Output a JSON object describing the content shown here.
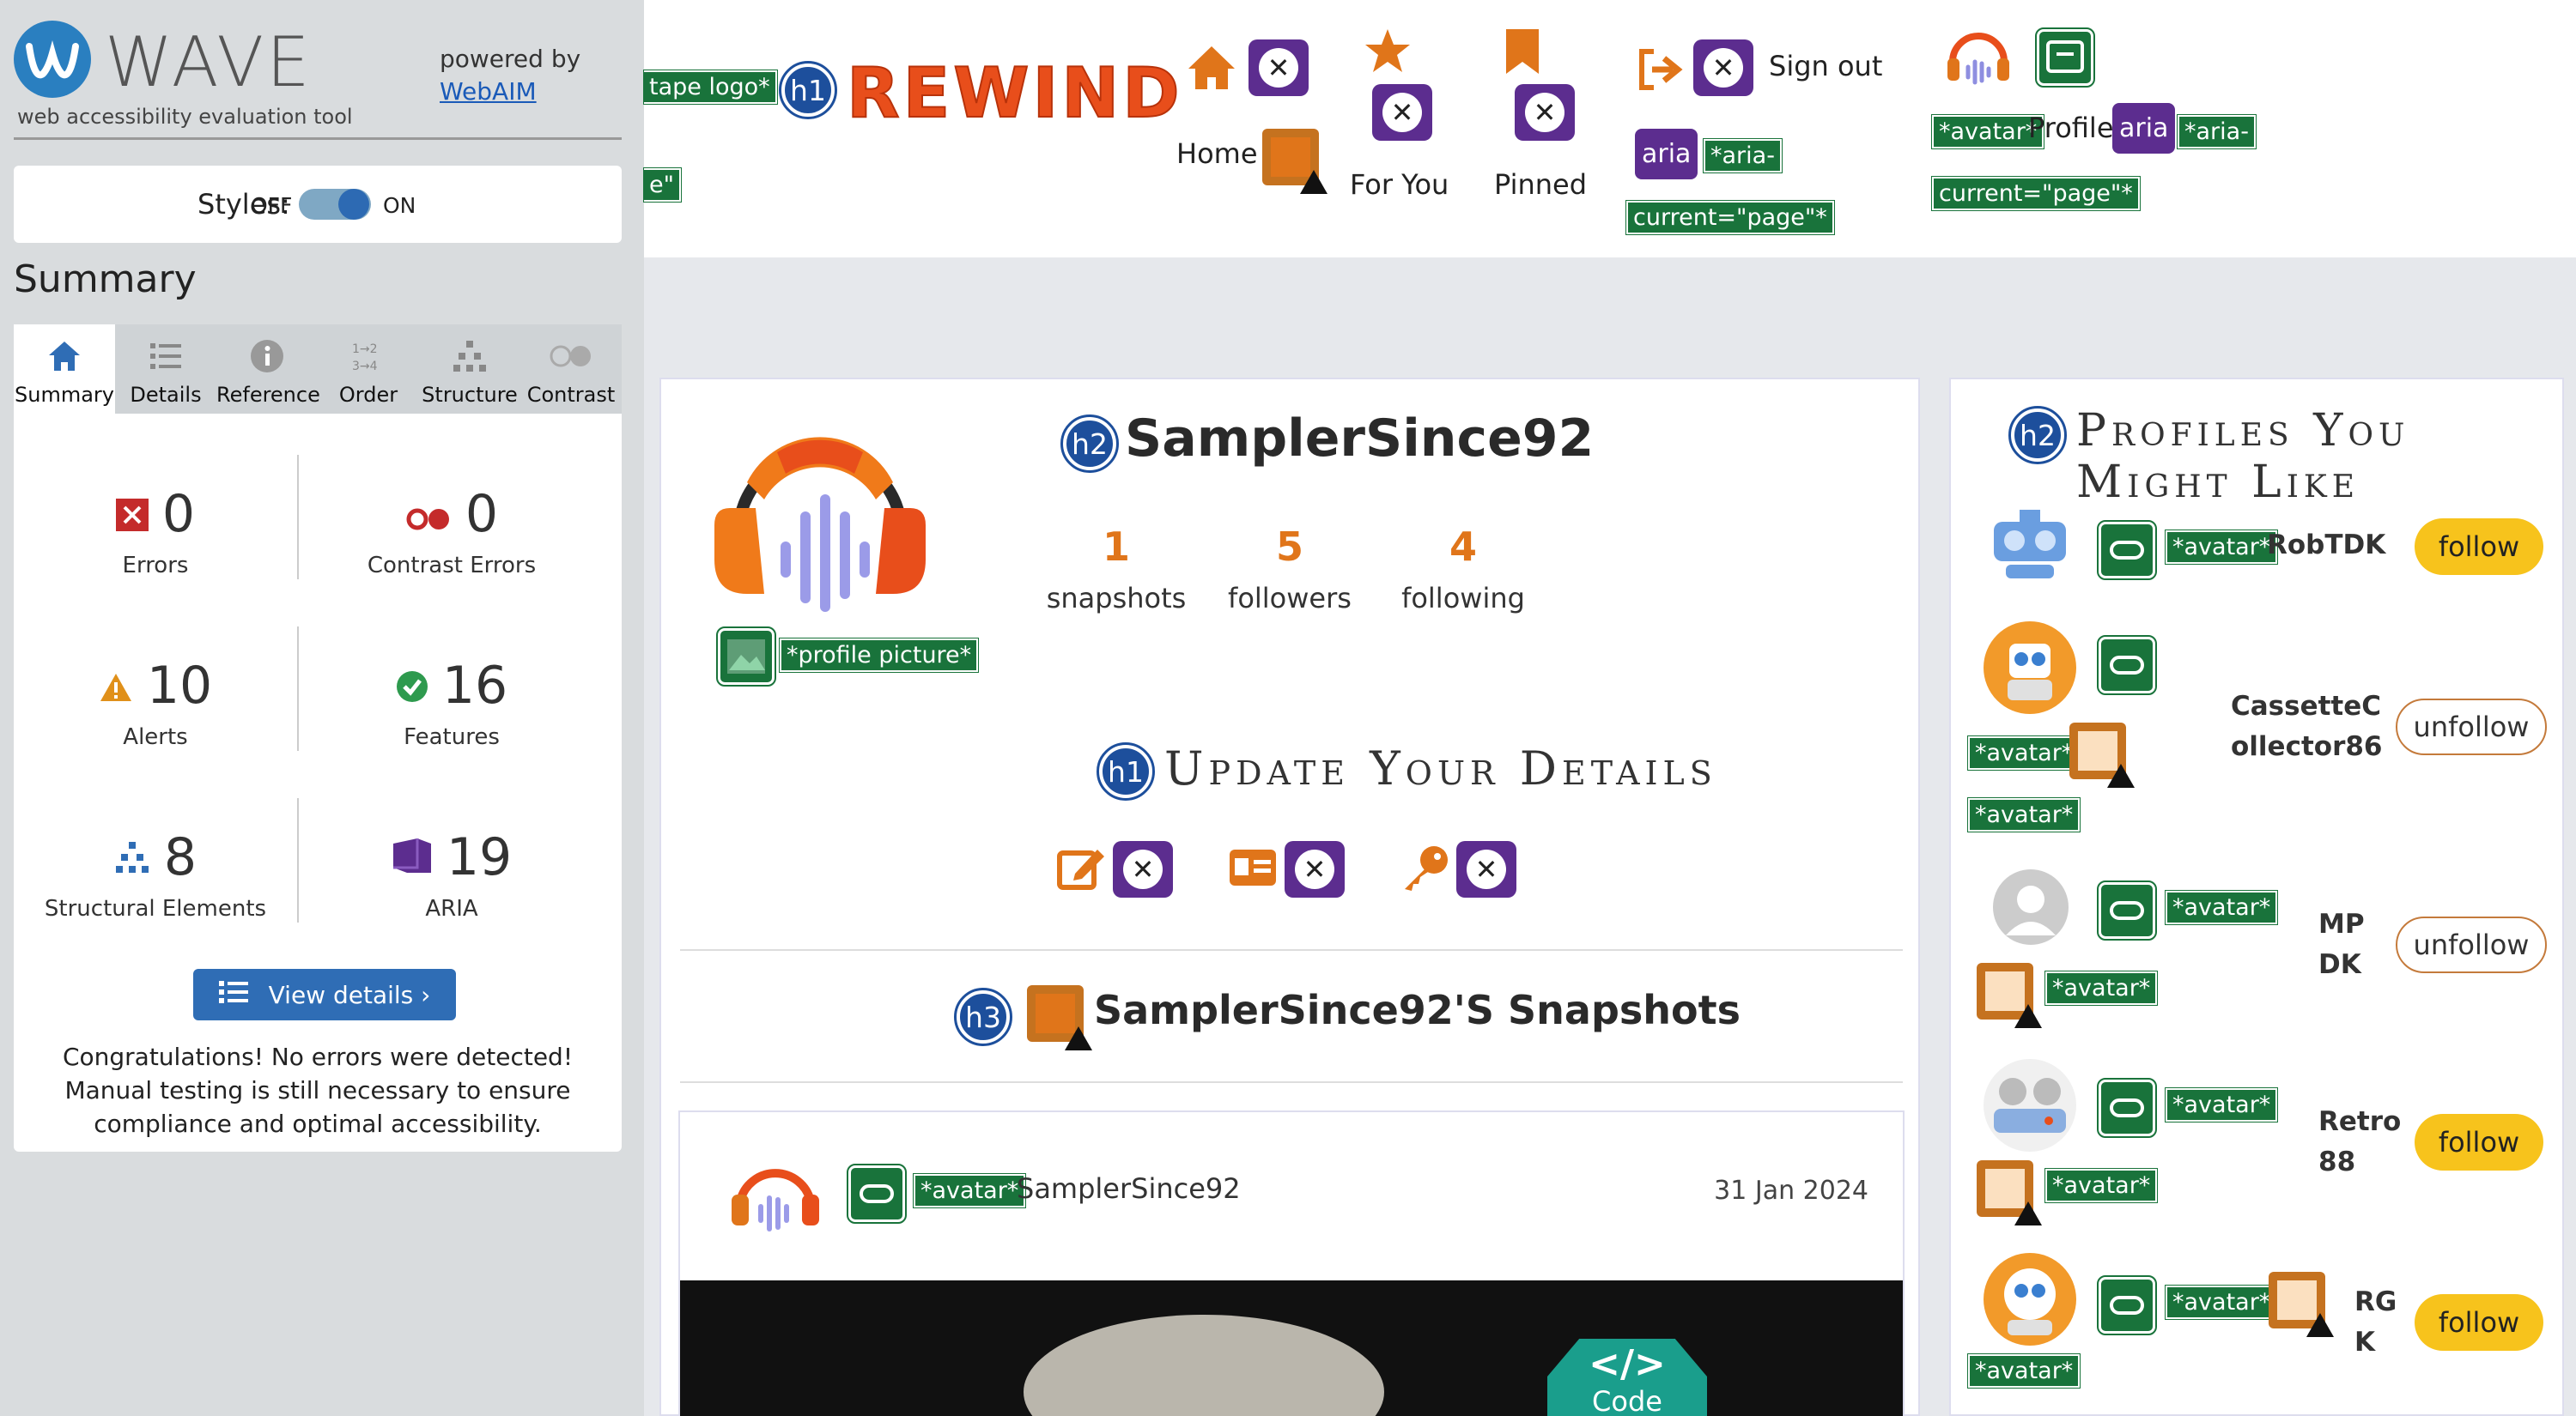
{
  "wave": {
    "title": "WAVE",
    "subtitle": "web accessibility evaluation tool",
    "powered_by": "powered by",
    "webaim": "WebAIM",
    "styles_label": "Styles:",
    "off": "OFF",
    "on": "ON",
    "summary_heading": "Summary",
    "tabs": [
      {
        "label": "Summary",
        "icon": "home-icon"
      },
      {
        "label": "Details",
        "icon": "list-icon"
      },
      {
        "label": "Reference",
        "icon": "info-icon"
      },
      {
        "label": "Order",
        "icon": "order-icon"
      },
      {
        "label": "Structure",
        "icon": "structure-icon"
      },
      {
        "label": "Contrast",
        "icon": "contrast-icon"
      }
    ],
    "stats": {
      "errors": {
        "value": "0",
        "label": "Errors"
      },
      "contrast_errors": {
        "value": "0",
        "label": "Contrast Errors"
      },
      "alerts": {
        "value": "10",
        "label": "Alerts"
      },
      "features": {
        "value": "16",
        "label": "Features"
      },
      "structural": {
        "value": "8",
        "label": "Structural Elements"
      },
      "aria": {
        "value": "19",
        "label": "ARIA"
      }
    },
    "view_details": "View details ›",
    "congrats": "Congratulations! No errors were detected! Manual testing is still necessary to ensure compliance and optimal accessibility."
  },
  "header": {
    "tape_logo_tag": "tape logo",
    "tape_logo_tag2": "e\"",
    "h1": "h1",
    "brand": "REWIND",
    "nav": {
      "home": "Home",
      "for_you": "For You",
      "pinned": "Pinned",
      "sign_out": "Sign out",
      "profile": "Profile"
    },
    "aria": "aria",
    "aria_current_1": "*aria-",
    "aria_current_2": "current=\"page\"*",
    "avatar_tag": "*avatar*"
  },
  "profile": {
    "h2": "h2",
    "username": "SamplerSince92",
    "profile_picture_tag": "*profile picture*",
    "stats": [
      {
        "n": "1",
        "l": "snapshots"
      },
      {
        "n": "5",
        "l": "followers"
      },
      {
        "n": "4",
        "l": "following"
      }
    ],
    "h1": "h1",
    "update_heading": "Update Your Details",
    "h3": "h3",
    "snapshots_heading": "SamplerSince92'S Snapshots",
    "post": {
      "avatar_tag": "*avatar*",
      "author": "SamplerSince92",
      "date": "31 Jan 2024",
      "code_label": "Code"
    }
  },
  "suggestions": {
    "h2": "h2",
    "heading": "Profiles You Might Like",
    "avatar_tag": "*avatar*",
    "people": [
      {
        "name": "RobTDK",
        "action": "follow"
      },
      {
        "name_line1": "CassetteC",
        "name_line2": "ollector86",
        "action": "unfollow"
      },
      {
        "name_line1": "MP",
        "name_line2": "DK",
        "action": "unfollow"
      },
      {
        "name_line1": "Retro",
        "name_line2": "88",
        "action": "follow"
      },
      {
        "name_line1": "RG",
        "name_line2": "K",
        "action": "follow"
      }
    ]
  },
  "colors": {
    "wave_blue": "#2a7fc0",
    "accent_orange": "#e0751a",
    "follow_yellow": "#f7c31c",
    "wave_green": "#19733b",
    "aria_purple": "#5c2d8f"
  }
}
